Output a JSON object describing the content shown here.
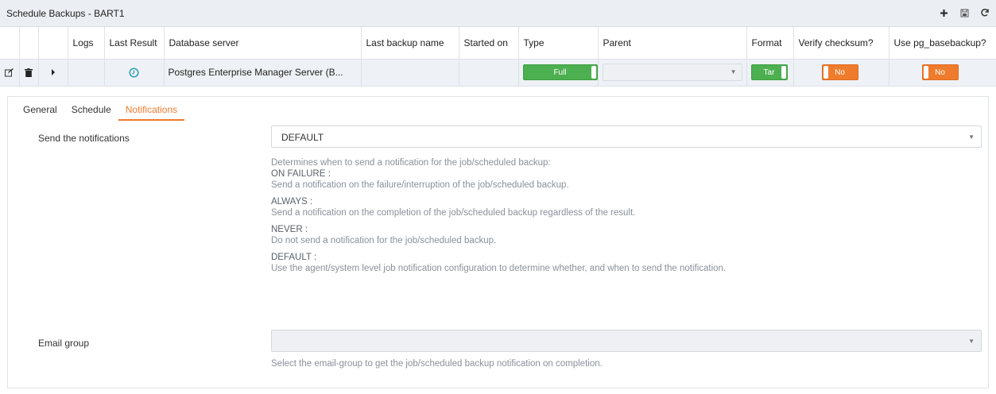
{
  "window": {
    "title": "Schedule Backups - BART1",
    "tools": [
      "plus-icon",
      "save-icon",
      "refresh-icon"
    ]
  },
  "grid": {
    "headers": {
      "logs": "Logs",
      "last_result": "Last Result",
      "database_server": "Database server",
      "last_backup_name": "Last backup name",
      "started_on": "Started on",
      "type": "Type",
      "parent": "Parent",
      "format": "Format",
      "verify_checksum": "Verify checksum?",
      "use_pg_basebackup": "Use pg_basebackup?"
    },
    "row": {
      "database_server": "Postgres Enterprise Manager Server (B...",
      "last_backup_name": "",
      "started_on": "",
      "type": "Full",
      "parent": "",
      "format": "Tar",
      "verify_checksum": "No",
      "use_pg_basebackup": "No"
    }
  },
  "tabs": [
    {
      "label": "General",
      "active": false
    },
    {
      "label": "Schedule",
      "active": false
    },
    {
      "label": "Notifications",
      "active": true
    }
  ],
  "notifications": {
    "label": "Send the notifications",
    "value": "DEFAULT",
    "help_intro": "Determines when to send a notification for the job/scheduled backup:",
    "options": [
      {
        "name": "ON FAILURE :",
        "desc": "Send a notification on the failure/interruption of the job/scheduled backup."
      },
      {
        "name": "ALWAYS :",
        "desc": "Send a notification on the completion of the job/scheduled backup regardless of the result."
      },
      {
        "name": "NEVER :",
        "desc": "Do not send a notification for the job/scheduled backup."
      },
      {
        "name": "DEFAULT :",
        "desc": "Use the agent/system level job notification configuration to determine whether, and when to send the notification."
      }
    ]
  },
  "email_group": {
    "label": "Email group",
    "value": "",
    "help": "Select the email-group to get the job/scheduled backup notification on completion."
  },
  "colors": {
    "accent": "#ef7b2c",
    "toggle_on": "#4caf50",
    "toggle_off": "#ef7b2c",
    "result_icon": "#2a9bb8"
  }
}
